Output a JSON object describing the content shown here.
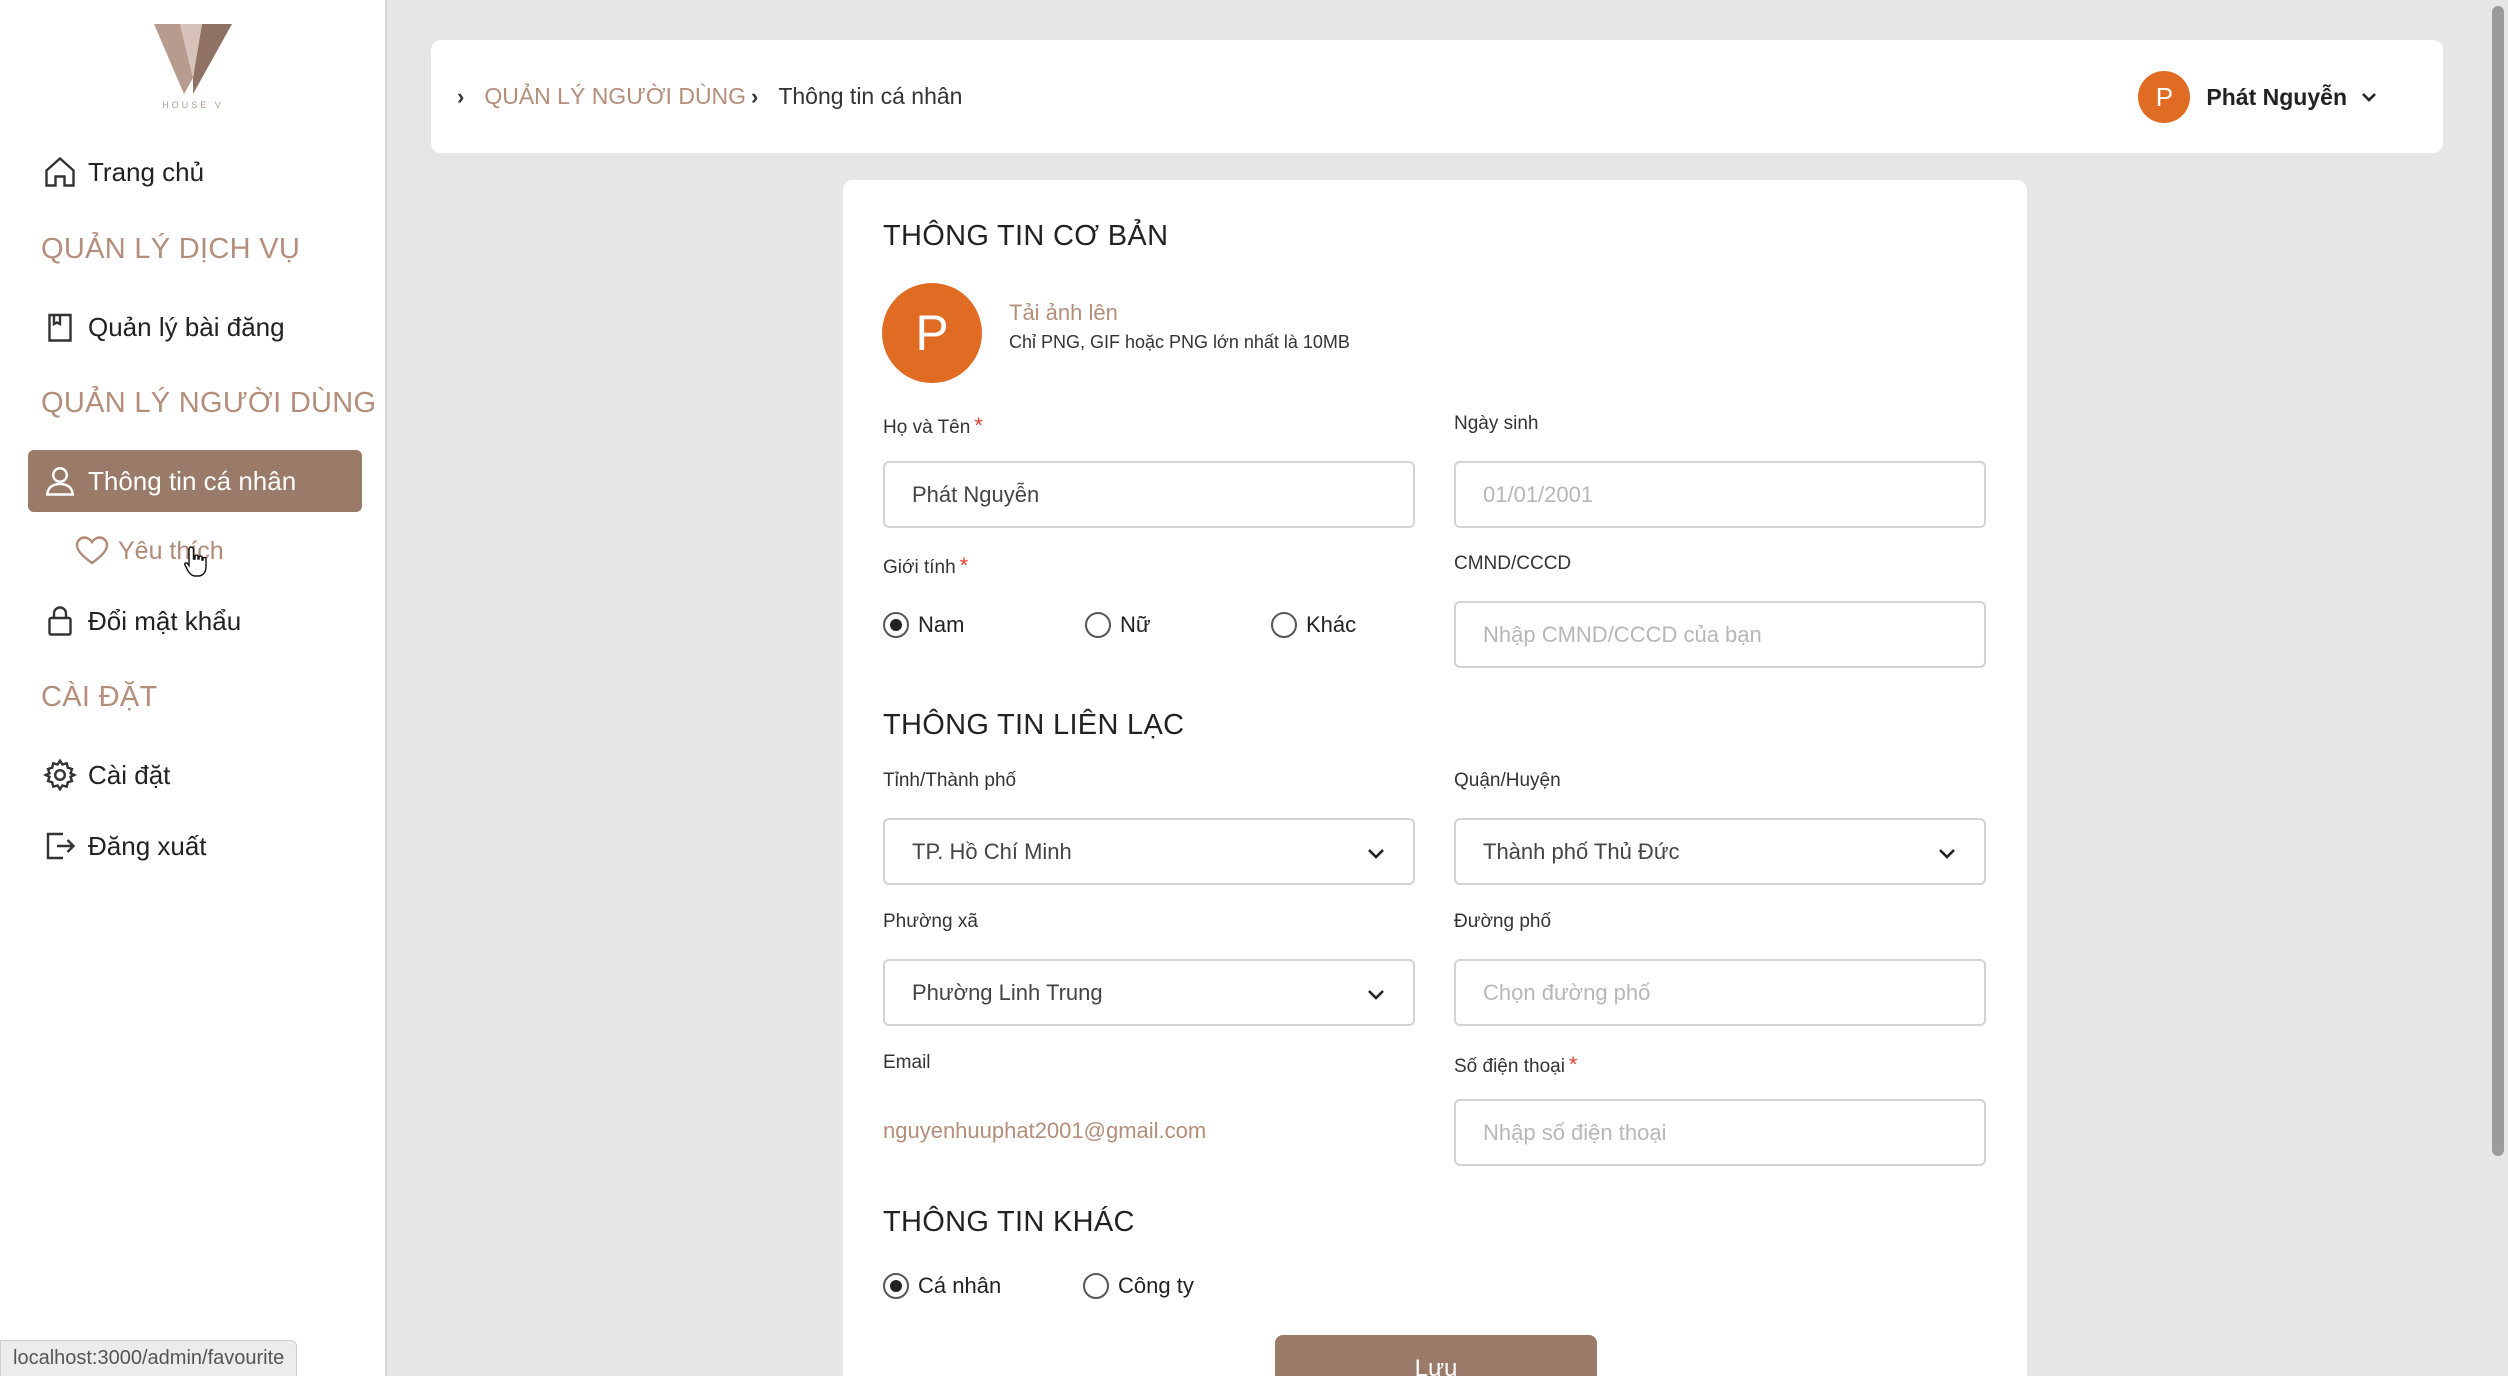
{
  "sidebar": {
    "logo_text": "HOUSE V",
    "items": [
      {
        "label": "Trang chủ",
        "icon": "home-icon"
      },
      {
        "label": "Quản lý bài đăng",
        "icon": "document-icon"
      },
      {
        "label": "Thông tin cá nhân",
        "icon": "user-icon"
      },
      {
        "label": "Yêu thích",
        "icon": "heart-icon"
      },
      {
        "label": "Đổi mật khẩu",
        "icon": "lock-icon"
      },
      {
        "label": "Cài đặt",
        "icon": "gear-icon"
      },
      {
        "label": "Đăng xuất",
        "icon": "logout-icon"
      }
    ],
    "sections": [
      "QUẢN LÝ DỊCH VỤ",
      "QUẢN LÝ NGƯỜI DÙNG",
      "CÀI ĐẶT"
    ],
    "active_item": "Thông tin cá nhân"
  },
  "status_url": "localhost:3000/admin/favourite",
  "header": {
    "breadcrumb": [
      "QUẢN LÝ NGƯỜI DÙNG",
      "Thông tin cá nhân"
    ],
    "user_initial": "P",
    "user_name": "Phát Nguyễn"
  },
  "form": {
    "basic_title": "THÔNG TIN CƠ BẢN",
    "avatar_initial": "P",
    "upload_label": "Tải ảnh lên",
    "upload_hint": "Chỉ PNG, GIF hoặc PNG lớn nhất là 10MB",
    "fullname_label": "Họ và Tên",
    "fullname_value": "Phát Nguyễn",
    "dob_label": "Ngày sinh",
    "dob_value": "01/01/2001",
    "gender_label": "Giới tính",
    "gender_options": [
      "Nam",
      "Nữ",
      "Khác"
    ],
    "gender_selected": "Nam",
    "id_label": "CMND/CCCD",
    "id_placeholder": "Nhập CMND/CCCD của bạn",
    "contact_title": "THÔNG TIN LIÊN LẠC",
    "province_label": "Tỉnh/Thành phố",
    "province_value": "TP. Hồ Chí Minh",
    "district_label": "Quận/Huyện",
    "district_value": "Thành phố Thủ Đức",
    "ward_label": "Phường xã",
    "ward_value": "Phường Linh Trung",
    "street_label": "Đường phố",
    "street_placeholder": "Chọn đường phố",
    "email_label": "Email",
    "email_value": "nguyenhuuphat2001@gmail.com",
    "phone_label": "Số điện thoại",
    "phone_placeholder": "Nhập số điện thoại",
    "other_title": "THÔNG TIN KHÁC",
    "type_options": [
      "Cá nhân",
      "Công ty"
    ],
    "type_selected": "Cá nhân",
    "save_label": "Lưu",
    "required_mark": "*"
  },
  "colors": {
    "accent": "#9a7a68",
    "accent_text": "#b48e7b",
    "avatar": "#e06b22",
    "required": "#e0422f"
  }
}
